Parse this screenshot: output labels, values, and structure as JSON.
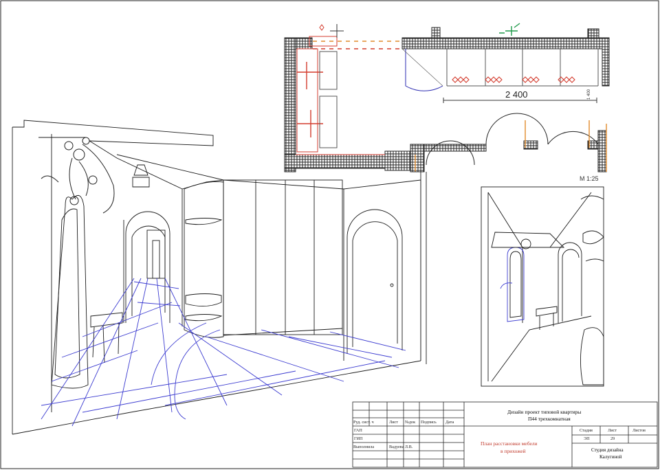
{
  "plan": {
    "dimension": "2 400",
    "scale": "М 1:25",
    "small_dim": "1 400"
  },
  "title_block": {
    "project_line1": "Дизайн проект типовой квартиры",
    "project_line2": "П44 трехкомнатная",
    "headers": [
      "Руд. сист. ч",
      "Лист",
      "№док",
      "Подпись",
      "Дата"
    ],
    "row1_label": "ГАП",
    "row2_label": "ГИП",
    "row3_label": "Выполнила",
    "row3_name": "Вадуева Л.В.",
    "sheet_title_line1": "План расстановки мебели",
    "sheet_title_line2": "в прихожей",
    "stage_header": "Стадия",
    "sheet_header": "Лист",
    "sheets_header": "Листов",
    "stage_value": "ЭП",
    "sheet_value": "29",
    "studio_line1": "Студия дизайна",
    "studio_line2": "Калугиной"
  },
  "colors": {
    "line": "#1a1a1a",
    "blue_floor": "#3a3ad0",
    "red_mark": "#d33a2c",
    "orange": "#e08a2a",
    "green": "#1f9a4a"
  }
}
